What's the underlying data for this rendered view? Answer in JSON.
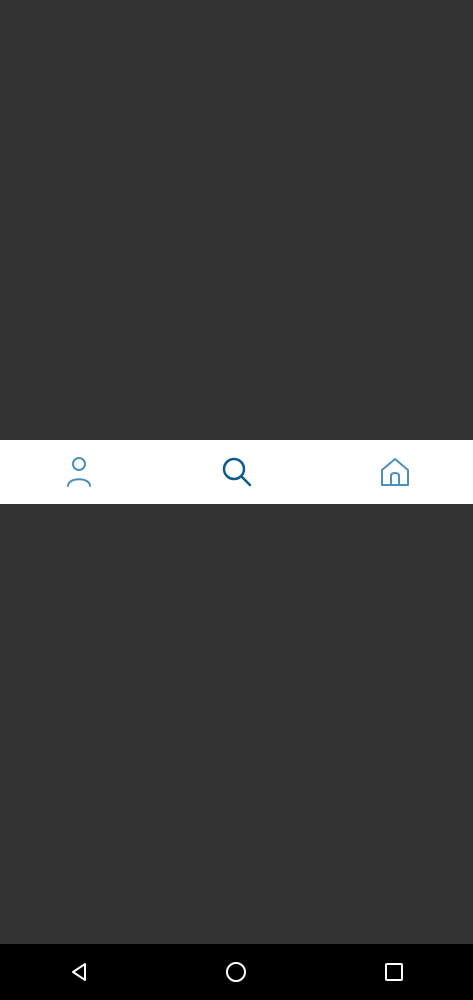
{
  "theme": {
    "overlay_color": "#333333",
    "tabbar_bg": "#ffffff",
    "icon_inactive": "#4a90b8",
    "icon_active": "#0b5a8a",
    "navbar_bg": "#000000",
    "navbar_icon": "#ffffff"
  },
  "tabbar": {
    "tabs": [
      {
        "icon": "person-icon",
        "active": false
      },
      {
        "icon": "search-icon",
        "active": true
      },
      {
        "icon": "home-icon",
        "active": false
      }
    ]
  },
  "system_nav": {
    "buttons": [
      {
        "icon": "back-triangle-icon"
      },
      {
        "icon": "home-circle-icon"
      },
      {
        "icon": "recents-square-icon"
      }
    ]
  }
}
